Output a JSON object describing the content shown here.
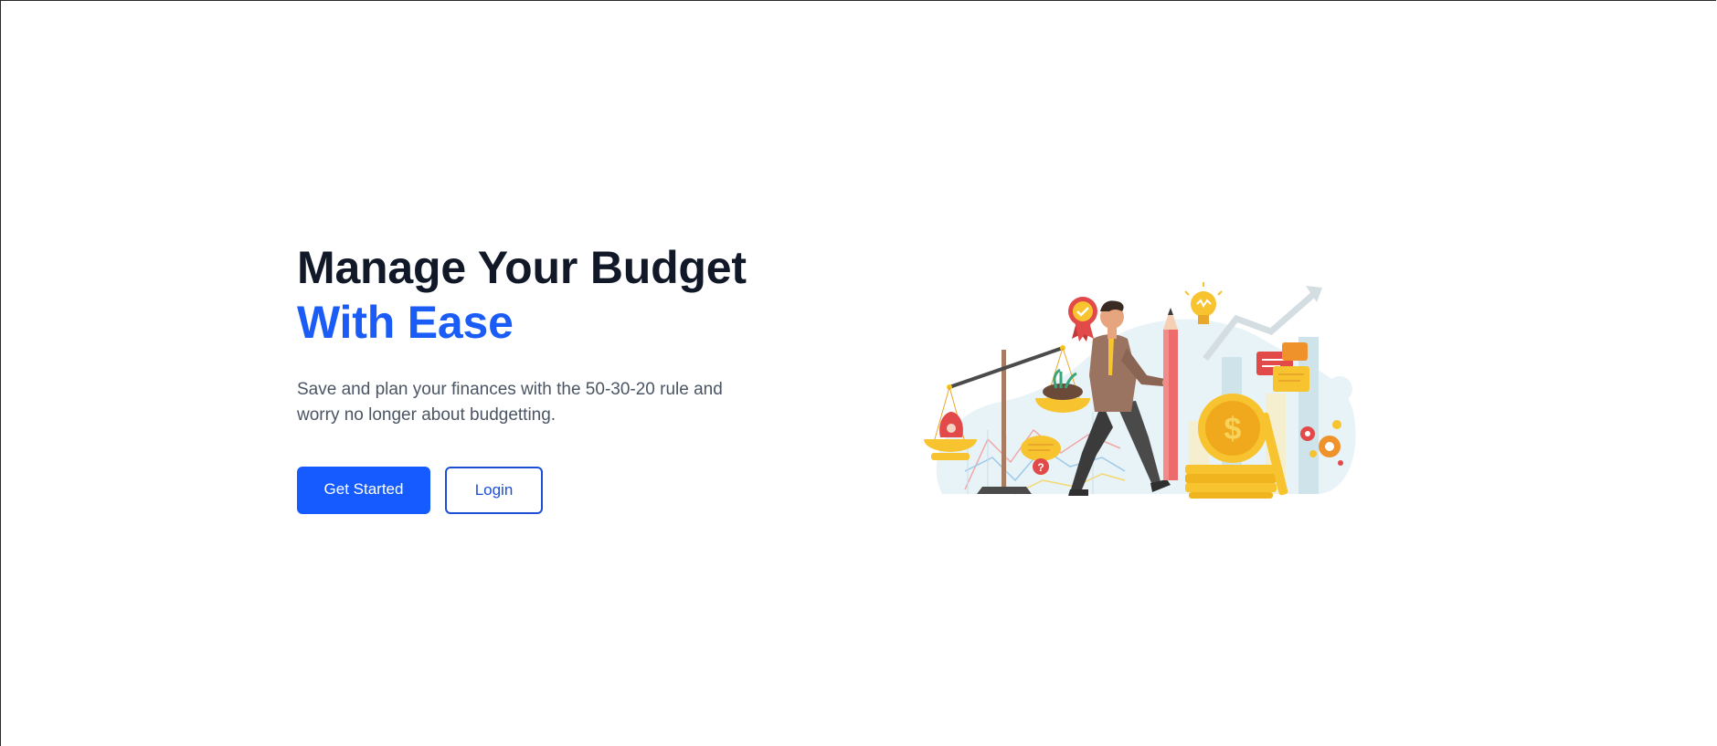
{
  "hero": {
    "headline_line1": "Manage Your Budget",
    "headline_line2": "With Ease",
    "subtitle": "Save and plan your finances with the 50-30-20 rule and worry no longer about budgetting.",
    "primary_cta": "Get Started",
    "secondary_cta": "Login"
  },
  "illustration": {
    "icon": "budget-illustration",
    "coin_symbol": "$",
    "help_symbol": "?"
  },
  "colors": {
    "accent": "#1a5cf5",
    "heading": "#111827",
    "body_text": "#4b5563",
    "button_primary": "#155bff",
    "button_outline": "#1d4ed8"
  }
}
